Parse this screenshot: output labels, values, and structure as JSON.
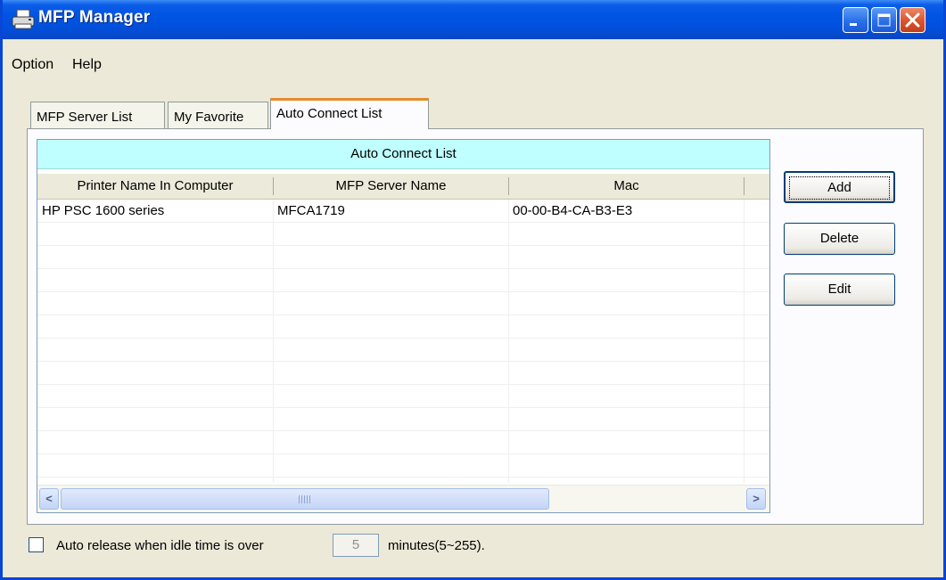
{
  "window": {
    "title": "MFP Manager",
    "icon": "printer-icon"
  },
  "menu": [
    {
      "label": "Option"
    },
    {
      "label": "Help"
    }
  ],
  "tabs": [
    {
      "label": "MFP Server List",
      "active": false
    },
    {
      "label": "My Favorite",
      "active": false
    },
    {
      "label": "Auto Connect List",
      "active": true
    }
  ],
  "list": {
    "caption": "Auto Connect List",
    "columns": [
      "Printer Name In Computer",
      "MFP Server Name",
      "Mac"
    ],
    "rows": [
      {
        "printer": "HP PSC 1600 series",
        "server": "MFCA1719",
        "mac": "00-00-B4-CA-B3-E3"
      }
    ]
  },
  "buttons": {
    "add": "Add",
    "delete": "Delete",
    "edit": "Edit"
  },
  "auto_release": {
    "label": "Auto release when idle time is over",
    "checked": false,
    "minutes_value": "5",
    "suffix": "minutes(5~255)."
  },
  "colors": {
    "titlebar": "#0054e3",
    "caption_bg": "#bfffff",
    "active_tab_accent": "#e68b2c",
    "window_bg": "#ece9d8"
  }
}
